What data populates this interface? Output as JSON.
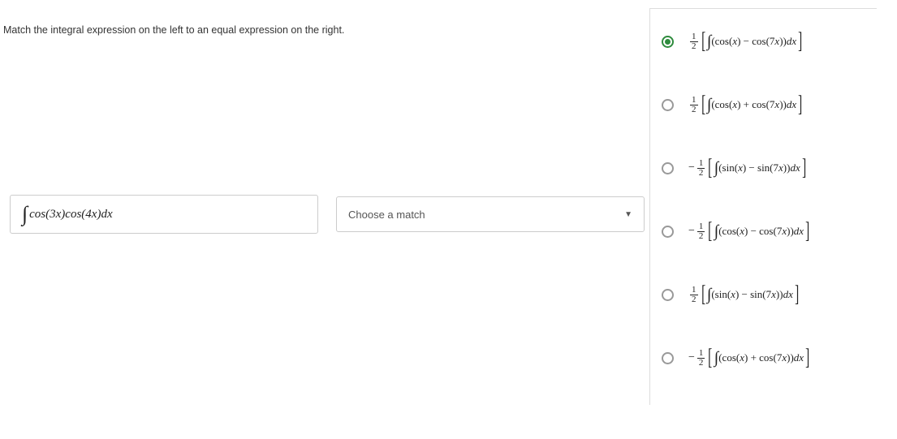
{
  "prompt": "Match the integral expression on the left to an equal expression on the right.",
  "leftExpression": {
    "integrand": "cos(3x)cos(4x)dx"
  },
  "dropdown": {
    "placeholder": "Choose a match"
  },
  "options": [
    {
      "sign": "",
      "coef_num": "1",
      "coef_den": "2",
      "body": "(cos(x) − cos(7x))dx",
      "selected": true
    },
    {
      "sign": "",
      "coef_num": "1",
      "coef_den": "2",
      "body": "(cos(x) + cos(7x))dx",
      "selected": false
    },
    {
      "sign": "−",
      "coef_num": "1",
      "coef_den": "2",
      "body": "(sin(x) − sin(7x))dx",
      "selected": false
    },
    {
      "sign": "−",
      "coef_num": "1",
      "coef_den": "2",
      "body": "(cos(x) − cos(7x))dx",
      "selected": false
    },
    {
      "sign": "",
      "coef_num": "1",
      "coef_den": "2",
      "body": "(sin(x) − sin(7x))dx",
      "selected": false
    },
    {
      "sign": "−",
      "coef_num": "1",
      "coef_den": "2",
      "body": "(cos(x) + cos(7x))dx",
      "selected": false
    }
  ]
}
